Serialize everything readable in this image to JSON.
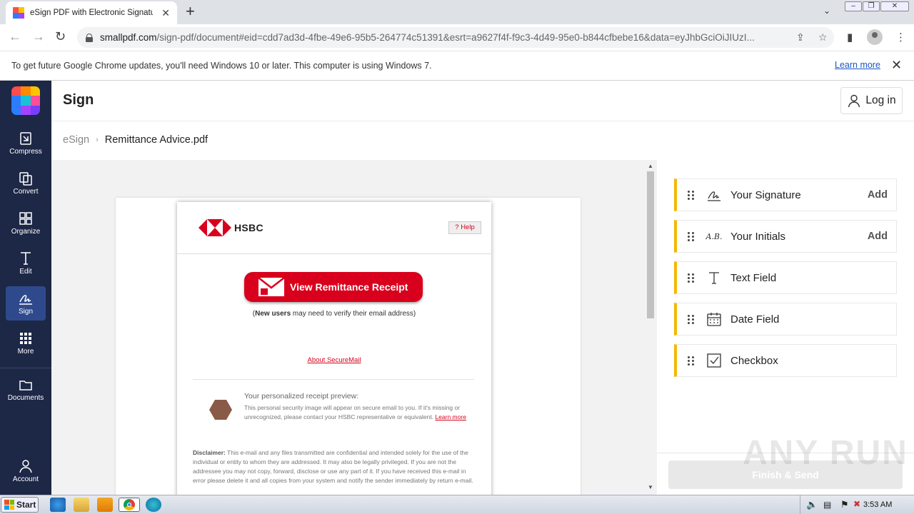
{
  "browser": {
    "tab_title": "eSign PDF with Electronic Signature |",
    "url_host": "smallpdf.com",
    "url_rest": "/sign-pdf/document#eid=cdd7ad3d-4fbe-49e6-95b5-264774c51391&esrt=a9627f4f-f9c3-4d49-95e0-b844cfbebe16&data=eyJhbGciOiJIUzI...",
    "infobar_text": "To get future Google Chrome updates, you'll need Windows 10 or later. This computer is using Windows 7.",
    "infobar_link": "Learn more"
  },
  "sidebar": {
    "items": [
      {
        "label": "Compress",
        "icon": "compress-icon"
      },
      {
        "label": "Convert",
        "icon": "convert-icon"
      },
      {
        "label": "Organize",
        "icon": "organize-icon"
      },
      {
        "label": "Edit",
        "icon": "edit-icon"
      },
      {
        "label": "Sign",
        "icon": "sign-icon",
        "active": true
      },
      {
        "label": "More",
        "icon": "more-icon"
      },
      {
        "label": "Documents",
        "icon": "folder-icon"
      },
      {
        "label": "Account",
        "icon": "user-icon"
      }
    ]
  },
  "header": {
    "title": "Sign",
    "login_label": "Log in"
  },
  "breadcrumb": {
    "root": "eSign",
    "current": "Remittance Advice.pdf"
  },
  "document": {
    "brand": "HSBC",
    "help_label": "? Help",
    "button_label": "View Remittance Receipt",
    "new_users_bold": "New users",
    "new_users_rest": " may need to verify their email address)",
    "new_users_open": "(",
    "about_link": "About SecureMail",
    "preview_title": "Your personalized receipt preview:",
    "preview_text": "This personal security image will appear on secure email to you. If it's missing or unrecognized, please contact your HSBC representative or equivalent.",
    "preview_link": "Learn more",
    "disclaimer_bold": "Disclaimer:",
    "disclaimer_text": " This e-mail and any files transmitted are confidential and intended solely for the use of the individual or entity to whom they are addressed. It may also be legally privileged. If you are not the addressee you may not copy, forward, disclose or use any part of it. If you have received this e-mail in error please delete it and all copies from your system and notify the sender immediately by return e-mail."
  },
  "fields": [
    {
      "label": "Your Signature",
      "icon": "signature-icon",
      "action": "Add"
    },
    {
      "label": "Your Initials",
      "icon": "initials-icon",
      "action": "Add"
    },
    {
      "label": "Text Field",
      "icon": "text-icon",
      "action": ""
    },
    {
      "label": "Date Field",
      "icon": "calendar-icon",
      "action": ""
    },
    {
      "label": "Checkbox",
      "icon": "checkbox-icon",
      "action": ""
    }
  ],
  "initials_glyph": "A.B.",
  "finish_label": "Finish & Send",
  "watermark": "ANY RUN",
  "taskbar": {
    "start_label": "Start",
    "clock": "3:53 AM"
  },
  "colors": {
    "sidebar_bg": "#1d2746",
    "accent_yellow": "#f5b700",
    "hsbc_red": "#d8001c"
  }
}
